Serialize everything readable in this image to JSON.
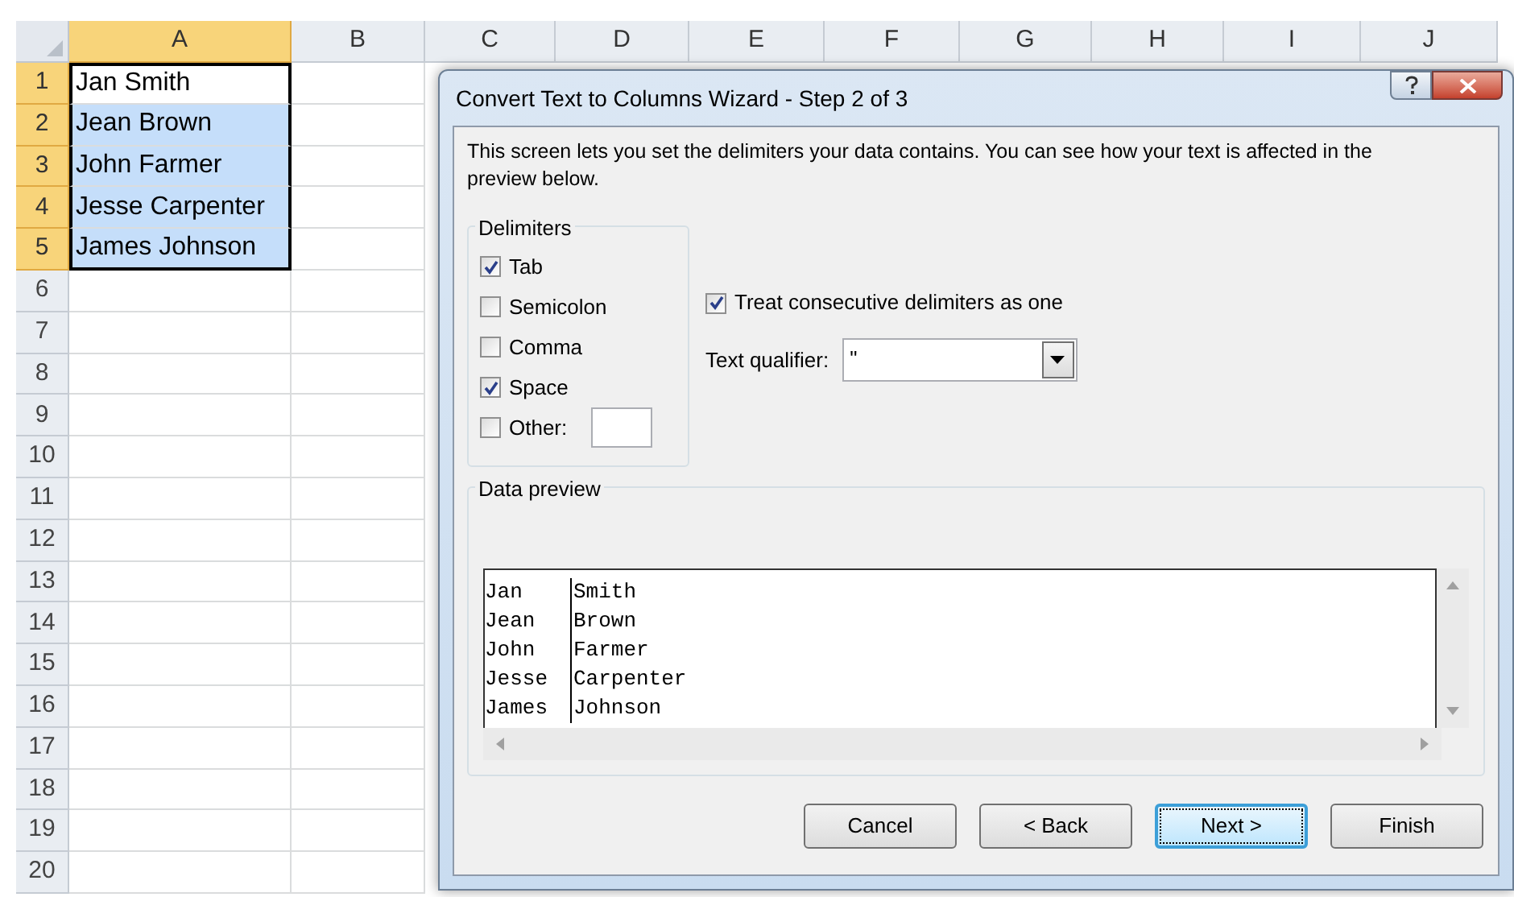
{
  "sheet": {
    "columns": [
      {
        "label": "A",
        "selected": true
      },
      {
        "label": "B",
        "selected": false
      },
      {
        "label": "C",
        "selected": false
      },
      {
        "label": "D",
        "selected": false
      },
      {
        "label": "E",
        "selected": false
      },
      {
        "label": "F",
        "selected": false
      },
      {
        "label": "G",
        "selected": false
      },
      {
        "label": "H",
        "selected": false
      },
      {
        "label": "I",
        "selected": false
      },
      {
        "label": "J",
        "selected": false
      }
    ],
    "rows": [
      {
        "number": "1",
        "value": "Jan Smith",
        "selected": true,
        "active": true
      },
      {
        "number": "2",
        "value": "Jean Brown",
        "selected": true,
        "active": false
      },
      {
        "number": "3",
        "value": "John Farmer",
        "selected": true,
        "active": false
      },
      {
        "number": "4",
        "value": "Jesse Carpenter",
        "selected": true,
        "active": false
      },
      {
        "number": "5",
        "value": "James Johnson",
        "selected": true,
        "active": false
      },
      {
        "number": "6",
        "selected": false
      },
      {
        "number": "7",
        "selected": false
      },
      {
        "number": "8",
        "selected": false
      },
      {
        "number": "9",
        "selected": false
      },
      {
        "number": "10",
        "selected": false
      },
      {
        "number": "11",
        "selected": false
      },
      {
        "number": "12",
        "selected": false
      },
      {
        "number": "13",
        "selected": false
      },
      {
        "number": "14",
        "selected": false
      },
      {
        "number": "15",
        "selected": false
      },
      {
        "number": "16",
        "selected": false
      },
      {
        "number": "17",
        "selected": false
      },
      {
        "number": "18",
        "selected": false
      },
      {
        "number": "19",
        "selected": false
      },
      {
        "number": "20",
        "selected": false
      }
    ]
  },
  "dialog": {
    "title": "Convert Text to Columns Wizard - Step 2 of 3",
    "description": "This screen lets you set the delimiters your data contains.  You can see how your text is affected in the preview below.",
    "delimiters": {
      "legend": "Delimiters",
      "items": [
        {
          "label": "Tab",
          "checked": true,
          "kind": "plain"
        },
        {
          "label": "Semicolon",
          "checked": false,
          "kind": "plain"
        },
        {
          "label": "Comma",
          "checked": false,
          "kind": "plain"
        },
        {
          "label": "Space",
          "checked": true,
          "kind": "plain"
        },
        {
          "label": "Other:",
          "checked": false,
          "kind": "other"
        }
      ]
    },
    "consecutive": {
      "label": "Treat consecutive delimiters as one",
      "checked": true
    },
    "qualifier": {
      "label": "Text qualifier:",
      "value": "\""
    },
    "preview": {
      "legend": "Data preview",
      "rows": [
        [
          "Jan",
          "Smith"
        ],
        [
          "Jean",
          "Brown"
        ],
        [
          "John",
          "Farmer"
        ],
        [
          "Jesse",
          "Carpenter"
        ],
        [
          "James",
          "Johnson"
        ]
      ]
    },
    "buttons": [
      {
        "label": "Cancel",
        "default": false
      },
      {
        "label": "< Back",
        "default": false
      },
      {
        "label": "Next >",
        "default": true
      },
      {
        "label": "Finish",
        "default": false
      }
    ]
  }
}
